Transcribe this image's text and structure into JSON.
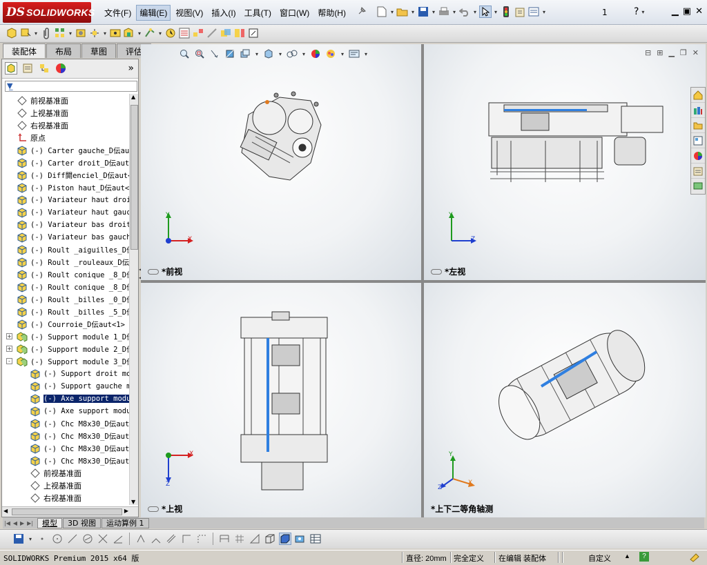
{
  "app": {
    "brand_ds": "DS",
    "brand_name": "SOLIDWORKS",
    "document_number": "1"
  },
  "menu": [
    "文件(F)",
    "编辑(E)",
    "视图(V)",
    "插入(I)",
    "工具(T)",
    "窗口(W)",
    "帮助(H)"
  ],
  "menu_active_index": 1,
  "command_tabs": [
    "装配体",
    "布局",
    "草图",
    "评估"
  ],
  "command_tab_active": 0,
  "tree": [
    {
      "label": "前视基准面",
      "icon": "plane-icon",
      "indent": 0
    },
    {
      "label": "上视基准面",
      "icon": "plane-icon",
      "indent": 0
    },
    {
      "label": "右视基准面",
      "icon": "plane-icon",
      "indent": 0
    },
    {
      "label": "原点",
      "icon": "origin-icon",
      "indent": 0
    },
    {
      "label": "(-) Carter gauche_D伝aut",
      "icon": "part-icon",
      "indent": 0,
      "mono": true
    },
    {
      "label": "(-) Carter droit_D伝aut<",
      "icon": "part-icon",
      "indent": 0,
      "mono": true
    },
    {
      "label": "(-) Diff閞enciel_D伝aut<",
      "icon": "part-icon",
      "indent": 0,
      "mono": true
    },
    {
      "label": "(-) Piston haut_D伝aut<1",
      "icon": "part-icon",
      "indent": 0,
      "mono": true
    },
    {
      "label": "(-) Variateur haut droit",
      "icon": "part-icon",
      "indent": 0,
      "mono": true
    },
    {
      "label": "(-) Variateur haut gauch",
      "icon": "part-icon",
      "indent": 0,
      "mono": true
    },
    {
      "label": "(-) Variateur bas droit_",
      "icon": "part-icon",
      "indent": 0,
      "mono": true
    },
    {
      "label": "(-) Variateur bas gauche",
      "icon": "part-icon",
      "indent": 0,
      "mono": true
    },
    {
      "label": "(-) Roult _aiguilles_D伝",
      "icon": "part-icon",
      "indent": 0,
      "mono": true
    },
    {
      "label": "(-) Roult _rouleaux_D伝a",
      "icon": "part-icon",
      "indent": 0,
      "mono": true
    },
    {
      "label": "(-) Roult conique _8_D伝",
      "icon": "part-icon",
      "indent": 0,
      "mono": true
    },
    {
      "label": "(-) Roult conique _8_D伝",
      "icon": "part-icon",
      "indent": 0,
      "mono": true
    },
    {
      "label": "(-) Roult _billes _0_D伝",
      "icon": "part-icon",
      "indent": 0,
      "mono": true
    },
    {
      "label": "(-) Roult _billes _5_D伝",
      "icon": "part-icon",
      "indent": 0,
      "mono": true
    },
    {
      "label": "(-) Courroie_D伝aut<1> (",
      "icon": "part-icon",
      "indent": 0,
      "mono": true
    },
    {
      "label": "(-) Support module 1_D伝",
      "icon": "assembly-icon",
      "indent": 0,
      "mono": true,
      "expander": "+"
    },
    {
      "label": "(-) Support module 2_D伝",
      "icon": "assembly-icon",
      "indent": 0,
      "mono": true,
      "expander": "+"
    },
    {
      "label": "(-) Support module 3_D伝",
      "icon": "assembly-icon",
      "indent": 0,
      "mono": true,
      "expander": "-"
    },
    {
      "label": "(-) Support droit moc",
      "icon": "part-icon",
      "indent": 1,
      "mono": true
    },
    {
      "label": "(-) Support gauche mc",
      "icon": "part-icon",
      "indent": 1,
      "mono": true
    },
    {
      "label": "(-) Axe support modul",
      "icon": "part-icon",
      "indent": 1,
      "mono": true,
      "selected": true
    },
    {
      "label": "(-) Axe support modul",
      "icon": "part-icon",
      "indent": 1,
      "mono": true
    },
    {
      "label": "(-) Chc M8x30_D伝aut<",
      "icon": "part-icon",
      "indent": 1,
      "mono": true
    },
    {
      "label": "(-) Chc M8x30_D伝aut<",
      "icon": "part-icon",
      "indent": 1,
      "mono": true
    },
    {
      "label": "(-) Chc M8x30_D伝aut<",
      "icon": "part-icon",
      "indent": 1,
      "mono": true
    },
    {
      "label": "(-) Chc M8x30_D伝aut<",
      "icon": "part-icon",
      "indent": 1,
      "mono": true
    },
    {
      "label": "前视基准面",
      "icon": "plane-icon",
      "indent": 1
    },
    {
      "label": "上视基准面",
      "icon": "plane-icon",
      "indent": 1
    },
    {
      "label": "右视基准面",
      "icon": "plane-icon",
      "indent": 1
    }
  ],
  "views": {
    "front": {
      "label": "*前视",
      "axis_x": "X",
      "axis_y": "Y"
    },
    "left": {
      "label": "*左视",
      "axis_z": "Z",
      "axis_y": "Y"
    },
    "top": {
      "label": "*上视",
      "axis_x": "X",
      "axis_z": "Z"
    },
    "iso": {
      "label": "*上下二等角轴测",
      "axis_x": "X",
      "axis_y": "Y",
      "axis_z": "Z"
    }
  },
  "bottom_tabs": [
    "模型",
    "3D 视图",
    "运动算例 1"
  ],
  "bottom_tab_active": 0,
  "status": {
    "product": "SOLIDWORKS Premium 2015 x64 版",
    "diameter": "直径: 20mm",
    "definition": "完全定义",
    "editing": "在编辑 装配体",
    "units": "自定义"
  },
  "colors": {
    "brand_red": "#c8141b",
    "selection": "#0a246a",
    "axis_x": "#d42020",
    "axis_y": "#1e9a1e",
    "axis_z": "#1f3fcf",
    "highlight_blue": "#2f7fe0"
  }
}
